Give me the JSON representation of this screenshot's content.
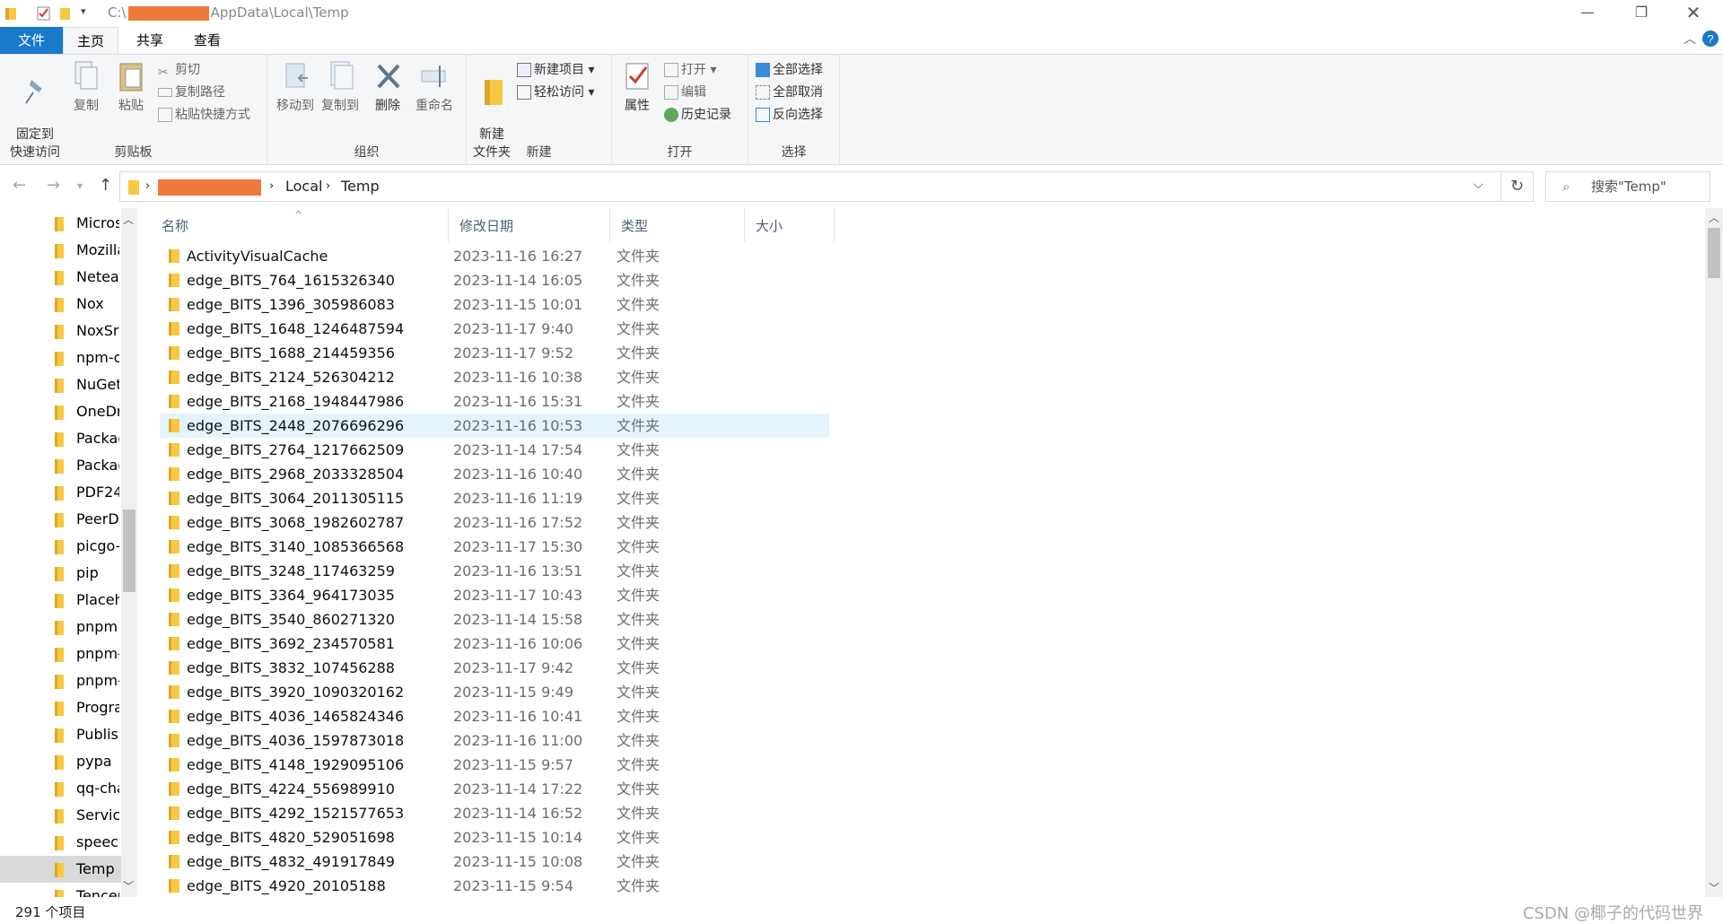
{
  "titlebar": {
    "path_prefix": "C:\\",
    "path_suffix": "AppData\\Local\\Temp",
    "minimize": "—",
    "restore": "❐",
    "close": "✕"
  },
  "tabs": {
    "file": "文件",
    "home": "主页",
    "share": "共享",
    "view": "查看"
  },
  "ribbon": {
    "clipboard": {
      "label": "剪贴板",
      "pin": "固定到\n快速访问",
      "copy": "复制",
      "paste": "粘贴",
      "cut": "剪切",
      "copy_path": "复制路径",
      "paste_shortcut": "粘贴快捷方式"
    },
    "organize": {
      "label": "组织",
      "move_to": "移动到",
      "copy_to": "复制到",
      "delete": "删除",
      "rename": "重命名"
    },
    "new": {
      "label": "新建",
      "new_folder": "新建\n文件夹",
      "new_item": "新建项目",
      "easy_access": "轻松访问"
    },
    "open": {
      "label": "打开",
      "properties": "属性",
      "open": "打开",
      "edit": "编辑",
      "history": "历史记录"
    },
    "select": {
      "label": "选择",
      "select_all": "全部选择",
      "select_none": "全部取消",
      "invert": "反向选择"
    }
  },
  "address": {
    "crumbs": [
      "Local",
      "Temp"
    ],
    "search_placeholder": "搜索\"Temp\""
  },
  "nav": {
    "items": [
      "Micros",
      "Mozilla",
      "Neteas",
      "Nox",
      "NoxSrv",
      "npm-c",
      "NuGet",
      "OneDri",
      "Packag",
      "Packag",
      "PDF24",
      "PeerDi",
      "picgo-",
      "pip",
      "Placeh",
      "pnpm",
      "pnpm-",
      "pnpm-",
      "Progra",
      "Publish",
      "pypa",
      "qq-cha",
      "Service",
      "speech",
      "Temp",
      "Tencer"
    ],
    "selected": "Temp"
  },
  "columns": {
    "name": "名称",
    "date": "修改日期",
    "type": "类型",
    "size": "大小"
  },
  "files": [
    {
      "name": "ActivityVisualCache",
      "date": "2023-11-16 16:27",
      "type": "文件夹"
    },
    {
      "name": "edge_BITS_764_1615326340",
      "date": "2023-11-14 16:05",
      "type": "文件夹"
    },
    {
      "name": "edge_BITS_1396_305986083",
      "date": "2023-11-15 10:01",
      "type": "文件夹"
    },
    {
      "name": "edge_BITS_1648_1246487594",
      "date": "2023-11-17 9:40",
      "type": "文件夹"
    },
    {
      "name": "edge_BITS_1688_214459356",
      "date": "2023-11-17 9:52",
      "type": "文件夹"
    },
    {
      "name": "edge_BITS_2124_526304212",
      "date": "2023-11-16 10:38",
      "type": "文件夹"
    },
    {
      "name": "edge_BITS_2168_1948447986",
      "date": "2023-11-16 15:31",
      "type": "文件夹"
    },
    {
      "name": "edge_BITS_2448_2076696296",
      "date": "2023-11-16 10:53",
      "type": "文件夹"
    },
    {
      "name": "edge_BITS_2764_1217662509",
      "date": "2023-11-14 17:54",
      "type": "文件夹"
    },
    {
      "name": "edge_BITS_2968_2033328504",
      "date": "2023-11-16 10:40",
      "type": "文件夹"
    },
    {
      "name": "edge_BITS_3064_2011305115",
      "date": "2023-11-16 11:19",
      "type": "文件夹"
    },
    {
      "name": "edge_BITS_3068_1982602787",
      "date": "2023-11-16 17:52",
      "type": "文件夹"
    },
    {
      "name": "edge_BITS_3140_1085366568",
      "date": "2023-11-17 15:30",
      "type": "文件夹"
    },
    {
      "name": "edge_BITS_3248_117463259",
      "date": "2023-11-16 13:51",
      "type": "文件夹"
    },
    {
      "name": "edge_BITS_3364_964173035",
      "date": "2023-11-17 10:43",
      "type": "文件夹"
    },
    {
      "name": "edge_BITS_3540_860271320",
      "date": "2023-11-14 15:58",
      "type": "文件夹"
    },
    {
      "name": "edge_BITS_3692_234570581",
      "date": "2023-11-16 10:06",
      "type": "文件夹"
    },
    {
      "name": "edge_BITS_3832_107456288",
      "date": "2023-11-17 9:42",
      "type": "文件夹"
    },
    {
      "name": "edge_BITS_3920_1090320162",
      "date": "2023-11-15 9:49",
      "type": "文件夹"
    },
    {
      "name": "edge_BITS_4036_1465824346",
      "date": "2023-11-16 10:41",
      "type": "文件夹"
    },
    {
      "name": "edge_BITS_4036_1597873018",
      "date": "2023-11-16 11:00",
      "type": "文件夹"
    },
    {
      "name": "edge_BITS_4148_1929095106",
      "date": "2023-11-15 9:57",
      "type": "文件夹"
    },
    {
      "name": "edge_BITS_4224_556989910",
      "date": "2023-11-14 17:22",
      "type": "文件夹"
    },
    {
      "name": "edge_BITS_4292_1521577653",
      "date": "2023-11-14 16:52",
      "type": "文件夹"
    },
    {
      "name": "edge_BITS_4820_529051698",
      "date": "2023-11-15 10:14",
      "type": "文件夹"
    },
    {
      "name": "edge_BITS_4832_491917849",
      "date": "2023-11-15 10:08",
      "type": "文件夹"
    },
    {
      "name": "edge_BITS_4920_20105188",
      "date": "2023-11-15 9:54",
      "type": "文件夹"
    }
  ],
  "highlighted_file": "edge_BITS_2448_2076696296",
  "status": {
    "count": "291 个项目",
    "watermark": "CSDN @椰子的代码世界"
  }
}
